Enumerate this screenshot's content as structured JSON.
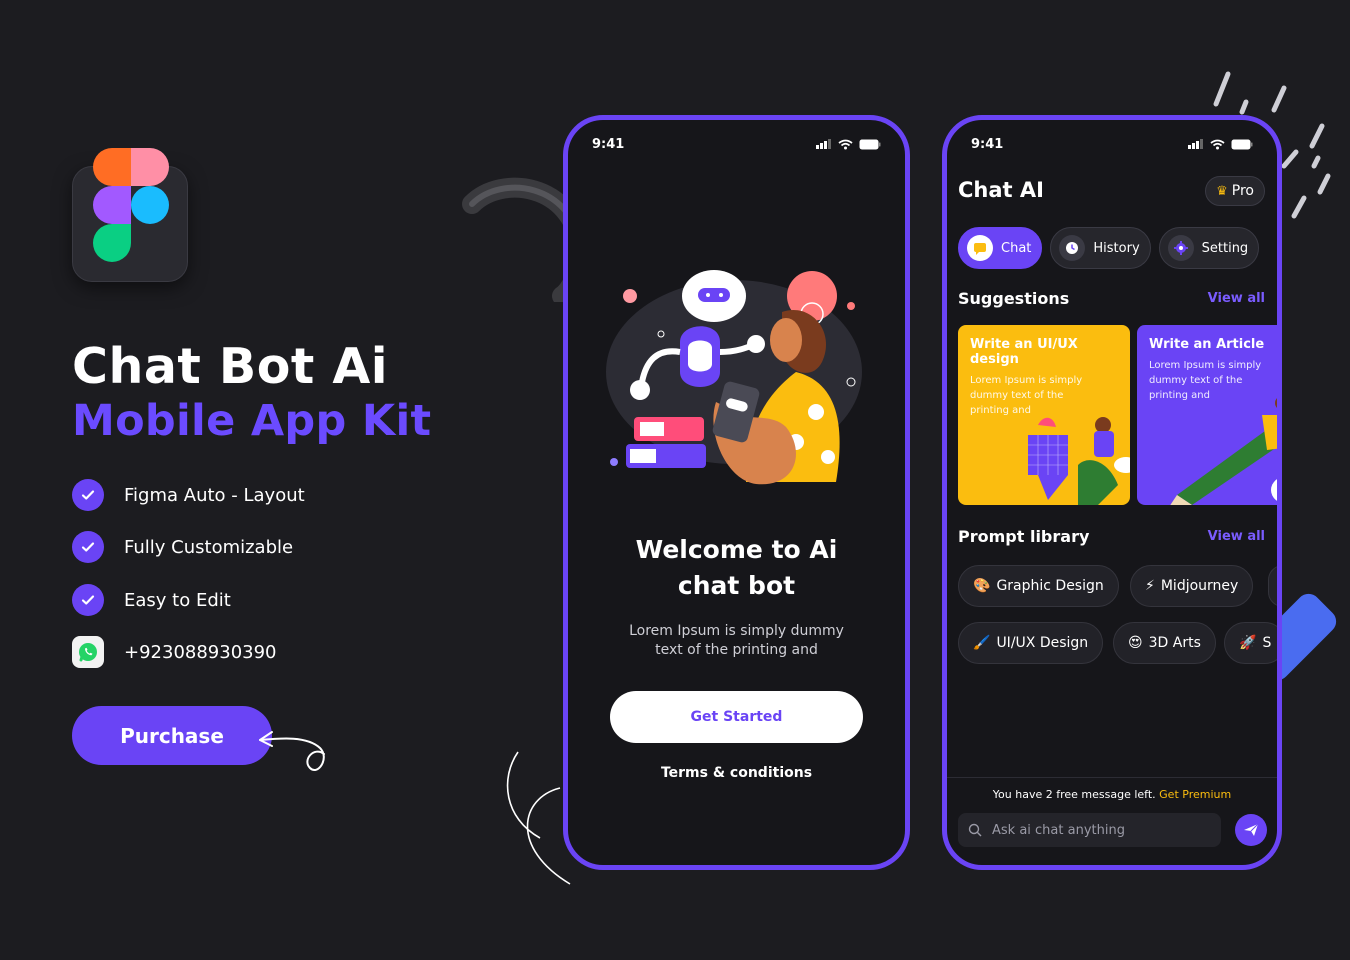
{
  "hero": {
    "title_line1": "Chat Bot Ai",
    "title_line2": "Mobile App Kit"
  },
  "features": [
    {
      "label": "Figma Auto - Layout",
      "icon": "check-icon"
    },
    {
      "label": "Fully Customizable",
      "icon": "check-icon"
    },
    {
      "label": "Easy to Edit",
      "icon": "check-icon"
    },
    {
      "label": "+923088930390",
      "icon": "whatsapp-icon"
    }
  ],
  "purchase_label": "Purchase",
  "colors": {
    "accent": "#6a44f5",
    "background": "#1c1c20",
    "yellow": "#fbbd0f"
  },
  "phone1": {
    "time": "9:41",
    "welcome_line1": "Welcome to Ai",
    "welcome_line2": "chat bot",
    "subtitle_line1": "Lorem Ipsum is simply dummy",
    "subtitle_line2": "text of the printing and",
    "get_started": "Get Started",
    "terms": "Terms & conditions"
  },
  "phone2": {
    "time": "9:41",
    "title": "Chat AI",
    "pro": "Pro",
    "tabs": [
      {
        "label": "Chat",
        "icon": "chat-icon"
      },
      {
        "label": "History",
        "icon": "clock-icon"
      },
      {
        "label": "Setting",
        "icon": "gear-icon"
      }
    ],
    "suggestions_title": "Suggestions",
    "view_all": "View all",
    "cards": [
      {
        "title": "Write an UI/UX design",
        "body": "Lorem Ipsum is simply dummy text of the printing and"
      },
      {
        "title": "Write an Article",
        "body": "Lorem Ipsum is simply dummy text of the printing and"
      }
    ],
    "prompt_title": "Prompt library",
    "prompt_view_all": "View all",
    "prompts_row1": [
      {
        "emoji": "🎨",
        "label": "Graphic Design"
      },
      {
        "emoji": "⚡",
        "label": "Midjourney"
      }
    ],
    "prompts_row2": [
      {
        "emoji": "🖌️",
        "label": "UI/UX Design"
      },
      {
        "emoji": "😍",
        "label": "3D Arts"
      },
      {
        "emoji": "🚀",
        "label": "S"
      }
    ],
    "free_msg": "You have 2 free message left.",
    "get_premium": "Get Premium",
    "input_placeholder": "Ask ai chat anything"
  }
}
